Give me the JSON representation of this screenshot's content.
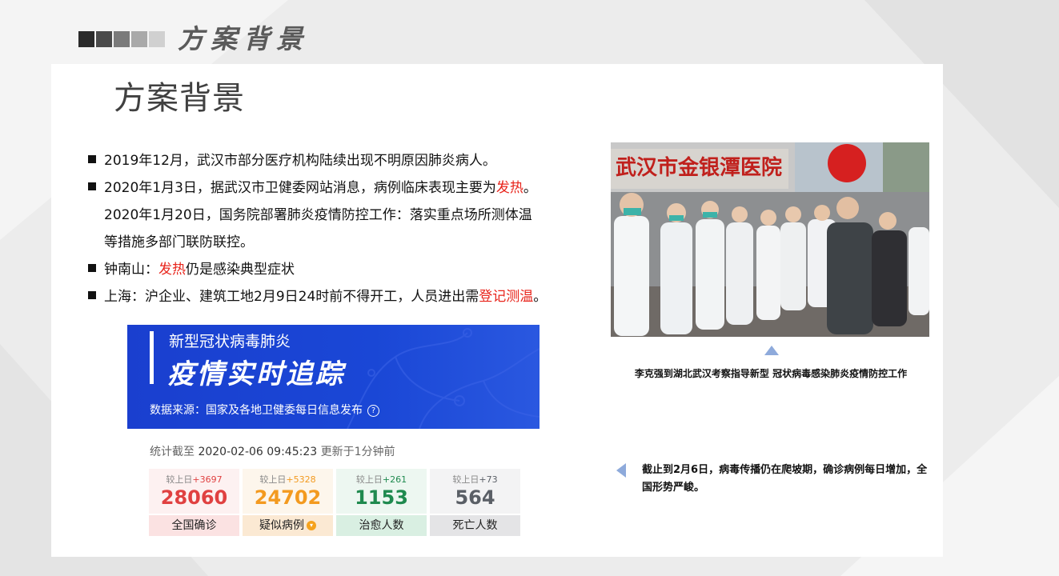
{
  "header": {
    "title": "方案背景",
    "squares": [
      "#2b2b2b",
      "#4a4a4a",
      "#7a7a7a",
      "#a9a9a9",
      "#d0d0d0"
    ]
  },
  "main": {
    "title": "方案背景",
    "bullets": [
      {
        "parts": [
          {
            "t": "2019年12月，武汉市部分医疗机构陆续出现不明原因肺炎病人。"
          }
        ]
      },
      {
        "parts": [
          {
            "t": "2020年1月3日，据武汉市卫健委网站消息，病例临床表现主要为"
          },
          {
            "t": "发热",
            "red": true
          },
          {
            "t": "。"
          }
        ]
      },
      {
        "cont": true,
        "parts": [
          {
            "t": "2020年1月20日，国务院部署肺炎疫情防控工作：落实重点场所测体温"
          }
        ]
      },
      {
        "cont": true,
        "parts": [
          {
            "t": "等措施多部门联防联控。"
          }
        ]
      },
      {
        "parts": [
          {
            "t": "钟南山："
          },
          {
            "t": "发热",
            "red": true
          },
          {
            "t": "仍是感染典型症状"
          }
        ]
      },
      {
        "parts": [
          {
            "t": "上海：沪企业、建筑工地2月9日24时前不得开工，人员进出需"
          },
          {
            "t": "登记测温",
            "red": true
          },
          {
            "t": "。"
          }
        ]
      }
    ]
  },
  "banner": {
    "subtitle": "新型冠状病毒肺炎",
    "title": "疫情实时追踪",
    "source": "数据来源：国家及各地卫健委每日信息发布",
    "help_icon": "question-circle-icon"
  },
  "stats": {
    "time_label": "统计截至",
    "time_value": "2020-02-06 09:45:23",
    "updated": "更新于1分钟前",
    "cards": [
      {
        "delta_label": "较上日",
        "delta": "+3697",
        "value": "28060",
        "label": "全国确诊",
        "color": "#e04141",
        "top_bg": "#fdf1f1",
        "bot_bg": "#fbe2e2",
        "tag": false
      },
      {
        "delta_label": "较上日",
        "delta": "+5328",
        "value": "24702",
        "label": "疑似病例",
        "color": "#f39a1f",
        "top_bg": "#fdf6ec",
        "bot_bg": "#fbe9d3",
        "tag": true
      },
      {
        "delta_label": "较上日",
        "delta": "+261",
        "value": "1153",
        "label": "治愈人数",
        "color": "#1f8a4f",
        "top_bg": "#edf7f1",
        "bot_bg": "#d9efe2",
        "tag": false
      },
      {
        "delta_label": "较上日",
        "delta": "+73",
        "value": "564",
        "label": "死亡人数",
        "color": "#5a5f66",
        "top_bg": "#f3f3f4",
        "bot_bg": "#e4e4e6",
        "tag": false
      }
    ]
  },
  "photo": {
    "sign": "武汉市金银潭医院",
    "caption": "李克强到湖北武汉考察指导新型 冠状病毒感染肺炎疫情防控工作"
  },
  "note": {
    "text": "截止到2月6日，病毒传播仍在爬坡期，确诊病例每日增加，全国形势严峻。"
  }
}
